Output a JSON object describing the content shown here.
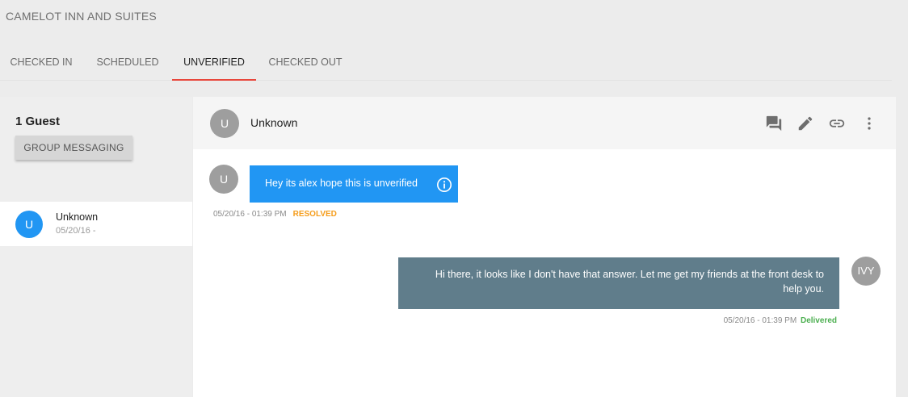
{
  "app": {
    "title": "CAMELOT INN AND SUITES"
  },
  "tabs": [
    {
      "label": "CHECKED IN",
      "active": false
    },
    {
      "label": "SCHEDULED",
      "active": false
    },
    {
      "label": "UNVERIFIED",
      "active": true
    },
    {
      "label": "CHECKED OUT",
      "active": false
    }
  ],
  "guests": {
    "count_label": "1 Guest",
    "group_messaging_label": "GROUP MESSAGING",
    "items": [
      {
        "initial": "U",
        "name": "Unknown",
        "date": "05/20/16 -"
      }
    ]
  },
  "conversation": {
    "header": {
      "initial": "U",
      "name": "Unknown",
      "icons": [
        "message-icon",
        "edit-icon",
        "link-icon",
        "more-vert-icon"
      ]
    },
    "messages": [
      {
        "direction": "incoming",
        "avatar": "U",
        "text": "Hey its alex hope this is unverified",
        "timestamp": "05/20/16 - 01:39 PM",
        "status": "RESOLVED"
      },
      {
        "direction": "outgoing",
        "avatar": "IVY",
        "text": "Hi there, it looks like I don't have that answer. Let me get my friends at the front desk to help you.",
        "timestamp": "05/20/16 - 01:39 PM",
        "status": "Delivered"
      }
    ]
  },
  "colors": {
    "accent_tab": "#e8473c",
    "incoming_bubble": "#2196f3",
    "outgoing_bubble": "#607d8b",
    "resolved": "#f59d1c",
    "delivered": "#4caf50"
  }
}
